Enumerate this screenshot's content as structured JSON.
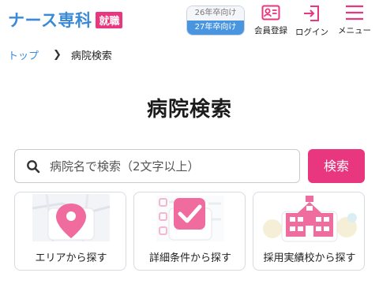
{
  "header": {
    "logo_text": "ナース専科",
    "logo_badge": "就職",
    "year_options": [
      "26年卒向け",
      "27年卒向け"
    ],
    "selected_year": "27年卒向け",
    "register_label": "会員登録",
    "login_label": "ログイン",
    "menu_label": "メニュー"
  },
  "breadcrumb": {
    "home": "トップ",
    "current": "病院検索"
  },
  "main": {
    "title": "病院検索",
    "search": {
      "placeholder": "病院名で検索（2文字以上）",
      "value": ""
    },
    "search_button": "検索",
    "cards": [
      {
        "label": "エリアから探す",
        "icon": "map-pin-icon"
      },
      {
        "label": "詳細条件から探す",
        "icon": "checkbox-icon"
      },
      {
        "label": "採用実績校から探す",
        "icon": "school-icon"
      }
    ]
  },
  "colors": {
    "brand_blue": "#3a8ad6",
    "accent_pink": "#e8367f",
    "toggle_blue": "#4a95e0"
  }
}
